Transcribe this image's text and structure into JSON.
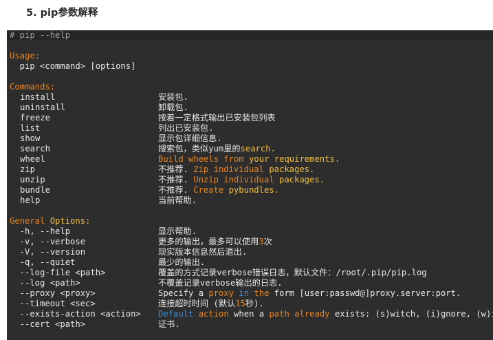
{
  "heading": "5. pip参数解释",
  "code": {
    "comment": "# pip --help",
    "usage_label": "Usage:",
    "usage_line": "  pip <command> [options]",
    "commands_label": "Commands:",
    "commands": [
      {
        "name": "install",
        "desc": "安装包."
      },
      {
        "name": "uninstall",
        "desc": "卸载包."
      },
      {
        "name": "freeze",
        "desc": "按着一定格式输出已安装包列表"
      },
      {
        "name": "list",
        "desc": "列出已安装包."
      },
      {
        "name": "show",
        "desc": "显示包详细信息."
      },
      {
        "name": "search",
        "desc_a": "搜索包，类似yum里的",
        "desc_b": "search."
      },
      {
        "name": "wheel",
        "desc_a": "Build wheels from",
        "desc_b": " your requirements."
      },
      {
        "name": "zip",
        "desc_a": "不推荐. ",
        "desc_b": "Zip individual",
        "desc_c": " packages."
      },
      {
        "name": "unzip",
        "desc_a": "不推荐. ",
        "desc_b": "Unzip individual",
        "desc_c": " packages."
      },
      {
        "name": "bundle",
        "desc_a": "不推荐. ",
        "desc_b": "Create",
        "desc_c": " pybundles."
      },
      {
        "name": "help",
        "desc": "当前帮助."
      }
    ],
    "general_label_a": "General",
    "general_label_b": " Options:",
    "options": [
      {
        "name": "  -h, --help",
        "desc": "显示帮助."
      },
      {
        "name": "  -v, --verbose",
        "desc_a": "更多的输出，最多可以使用",
        "desc_b": "3",
        "desc_c": "次"
      },
      {
        "name": "  -V, --version",
        "desc": "现实版本信息然后退出."
      },
      {
        "name": "  -q, --quiet",
        "desc": "最少的输出."
      },
      {
        "name": "  --log-file <path>",
        "desc": "覆盖的方式记录verbose错误日志，默认文件：/root/.pip/pip.log"
      },
      {
        "name": "  --log <path>",
        "desc": "不覆盖记录verbose输出的日志."
      },
      {
        "name": "  --proxy <proxy>",
        "desc_a": "Specify a ",
        "desc_b": "proxy",
        "desc_c": " in",
        "desc_d": " the",
        "desc_e": " form [user:passwd@]proxy.server:port."
      },
      {
        "name": "  --timeout <sec>",
        "desc_a": "连接超时时间 (默认",
        "desc_b": "15",
        "desc_c": "秒)."
      },
      {
        "name": "  --exists-action <action>",
        "desc_a": "Default",
        "desc_b": " action",
        "desc_c": " when a ",
        "desc_d": "path",
        "desc_e": " already",
        "desc_f": " exists: (s)witch, (i)gnore, (w)i"
      },
      {
        "name": "  --cert <path>",
        "desc": "证书."
      }
    ]
  },
  "colors": {
    "background": "#2d2d2d",
    "stripe": "#262626",
    "text": "#e8e8e8",
    "keyword": "#e8851f",
    "builtin": "#f2c03a",
    "blue": "#3c8fd6",
    "comment": "#9a9a9a"
  }
}
